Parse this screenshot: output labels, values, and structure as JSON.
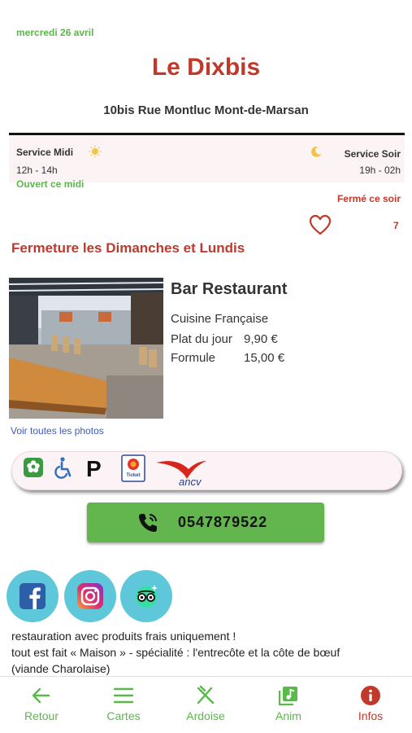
{
  "header": {
    "date": "mercredi 26 avril",
    "restaurant_name": "Le Dixbis",
    "address": "10bis Rue Montluc Mont-de-Marsan"
  },
  "services": {
    "midi": {
      "label": "Service Midi",
      "hours": "12h - 14h",
      "status": "Ouvert ce midi",
      "icon": "sun-icon"
    },
    "soir": {
      "label": "Service Soir",
      "hours": "19h - 02h",
      "status": "Fermé ce soir",
      "icon": "moon-icon"
    }
  },
  "likes": {
    "count": "7",
    "icon": "heart-icon"
  },
  "closure_notice": "Fermeture les Dimanches et Lundis",
  "details": {
    "type": "Bar Restaurant",
    "cuisine": "Cuisine Française",
    "prices": [
      {
        "label": "Plat du jour",
        "value": "9,90 €"
      },
      {
        "label": "Formule",
        "value": "15,00 €"
      }
    ],
    "see_photos": "Voir toutes les photos"
  },
  "amenities": {
    "icons": [
      "terrace-flower-icon",
      "wheelchair-accessible-icon",
      "parking-icon",
      "ticket-restaurant-icon",
      "ancv-icon"
    ],
    "ticket_label": "Ticket",
    "ancv_label": "ancv"
  },
  "phone": {
    "number": "0547879522",
    "icon": "phone-icon"
  },
  "social": [
    "facebook-icon",
    "instagram-icon",
    "tripadvisor-icon"
  ],
  "description": [
    "restauration avec produits frais uniquement !",
    "tout est fait « Maison » - spécialité : l'entrecôte et la côte de bœuf",
    "(viande Charolaise)"
  ],
  "tabs": [
    {
      "label": "Retour",
      "icon": "back-arrow-icon"
    },
    {
      "label": "Cartes",
      "icon": "menu-lines-icon"
    },
    {
      "label": "Ardoise",
      "icon": "fork-knife-icon"
    },
    {
      "label": "Anim",
      "icon": "music-note-icon"
    },
    {
      "label": "Infos",
      "icon": "info-icon",
      "active": true
    }
  ],
  "colors": {
    "brand_red": "#c0392b",
    "green": "#5bb84a",
    "button_green": "#63b54e",
    "social_cyan": "#5ec7d9",
    "link_blue": "#3b5bbf"
  }
}
